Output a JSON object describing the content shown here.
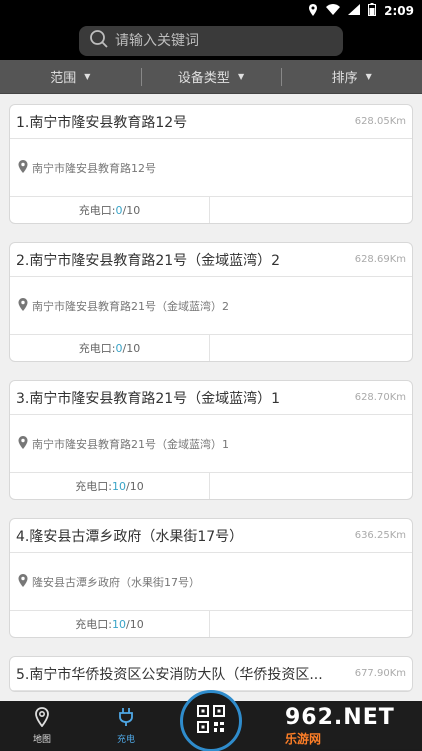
{
  "status_bar": {
    "time": "2:09"
  },
  "search": {
    "placeholder": "请输入关键词"
  },
  "filters": [
    {
      "label": "范围"
    },
    {
      "label": "设备类型"
    },
    {
      "label": "排序"
    }
  ],
  "stations": [
    {
      "title": "1.南宁市隆安县教育路12号",
      "distance": "628.05Km",
      "address": "南宁市隆安县教育路12号",
      "ports_label": "充电口:",
      "ports_free": "0",
      "ports_total": "/10"
    },
    {
      "title": "2.南宁市隆安县教育路21号（金域蓝湾）2",
      "distance": "628.69Km",
      "address": "南宁市隆安县教育路21号（金域蓝湾）2",
      "ports_label": "充电口:",
      "ports_free": "0",
      "ports_total": "/10"
    },
    {
      "title": "3.南宁市隆安县教育路21号（金域蓝湾）1",
      "distance": "628.70Km",
      "address": "南宁市隆安县教育路21号（金域蓝湾）1",
      "ports_label": "充电口:",
      "ports_free": "10",
      "ports_total": "/10"
    },
    {
      "title": "4.隆安县古潭乡政府（水果街17号）",
      "distance": "636.25Km",
      "address": "隆安县古潭乡政府（水果街17号）",
      "ports_label": "充电口:",
      "ports_free": "10",
      "ports_total": "/10"
    },
    {
      "title": "5.南宁市华侨投资区公安消防大队（华侨投资区...",
      "distance": "677.90Km",
      "address": "",
      "ports_label": "",
      "ports_free": "",
      "ports_total": ""
    }
  ],
  "nav": {
    "map_label": "地图",
    "charge_label": "充电"
  },
  "watermark": {
    "top": "962.NET",
    "bottom": "乐游网"
  },
  "colors": {
    "accent": "#3aa4c7",
    "nav_active": "#4fa8e6"
  }
}
